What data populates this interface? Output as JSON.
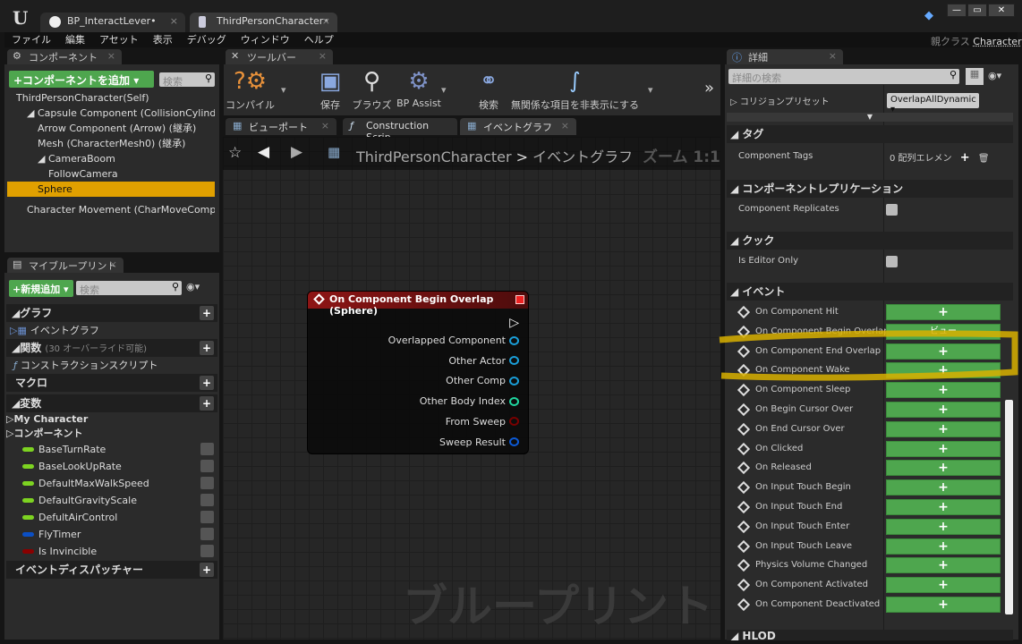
{
  "window": {
    "tabs": [
      {
        "label": "BP_InteractLever•"
      },
      {
        "label": "ThirdPersonCharacter•"
      }
    ],
    "parent_class_label": "親クラス",
    "parent_class": "Character",
    "controls": [
      "—",
      "▭",
      "✕"
    ]
  },
  "menu": [
    "ファイル",
    "編集",
    "アセット",
    "表示",
    "デバッグ",
    "ウィンドウ",
    "ヘルプ"
  ],
  "components": {
    "tab": "コンポーネント",
    "add_button": "+コンポーネントを追加",
    "search_placeholder": "検索",
    "tree": [
      {
        "label": "ThirdPersonCharacter(Self)",
        "indent": 0
      },
      {
        "label": "◢ Capsule Component (CollisionCylinder) (継承)",
        "indent": 1
      },
      {
        "label": "Arrow Component (Arrow) (継承)",
        "indent": 2
      },
      {
        "label": "Mesh (CharacterMesh0) (継承)",
        "indent": 2
      },
      {
        "label": "◢ CameraBoom",
        "indent": 2
      },
      {
        "label": "FollowCamera",
        "indent": 3
      },
      {
        "label": "Sphere",
        "indent": 2,
        "selected": true
      },
      {
        "label": "Character Movement (CharMoveComp) (継承)",
        "indent": 1
      }
    ]
  },
  "my_blueprint": {
    "tab": "マイブループリント",
    "add_button": "+新規追加",
    "search_placeholder": "検索",
    "graph_section": "◢グラフ",
    "event_graph": "イベントグラフ",
    "functions_section": "◢関数",
    "functions_note": "(30 オーバーライド可能)",
    "construction_script": "コンストラクションスクリプト",
    "macros_section": "マクロ",
    "variables_section": "◢変数",
    "my_character": "My Character",
    "components_cat": "コンポーネント",
    "variables": [
      {
        "name": "BaseTurnRate",
        "color": "#7dd321"
      },
      {
        "name": "BaseLookUpRate",
        "color": "#7dd321"
      },
      {
        "name": "DefaultMaxWalkSpeed",
        "color": "#7dd321"
      },
      {
        "name": "DefaultGravityScale",
        "color": "#7dd321"
      },
      {
        "name": "DefultAirControl",
        "color": "#7dd321"
      },
      {
        "name": "FlyTimer",
        "color": "#0b4fc4"
      },
      {
        "name": "Is Invincible",
        "color": "#8a0000"
      }
    ],
    "dispatchers_section": "イベントディスパッチャー"
  },
  "toolbar": {
    "tab": "ツールバー",
    "buttons": [
      "コンパイル",
      "保存",
      "ブラウズ",
      "BP Assist",
      "検索",
      "無関係な項目を非表示にする"
    ]
  },
  "graph_tabs": [
    {
      "label": "ビューポート"
    },
    {
      "label": "Construction Scrip"
    },
    {
      "label": "イベントグラフ"
    }
  ],
  "graph": {
    "breadcrumb_root": "ThirdPersonCharacter",
    "breadcrumb_sep": ">",
    "breadcrumb_current": "イベントグラフ",
    "zoom": "ズーム 1:1",
    "watermark": "ブループリント",
    "node": {
      "title": "On Component Begin Overlap (Sphere)",
      "pins": [
        {
          "label": "Overlapped Component",
          "color": "#1a9ed8"
        },
        {
          "label": "Other Actor",
          "color": "#1a9ed8"
        },
        {
          "label": "Other Comp",
          "color": "#1a9ed8"
        },
        {
          "label": "Other Body Index",
          "color": "#1fd6a0"
        },
        {
          "label": "From Sweep",
          "color": "#7a0000"
        },
        {
          "label": "Sweep Result",
          "color": "#0c5ad6"
        }
      ]
    }
  },
  "details": {
    "tab": "詳細",
    "search_placeholder": "詳細の検索",
    "collision_preset_label": "▷ コリジョンプリセット",
    "collision_preset_value": "OverlapAllDynamic ▾",
    "tags_section": "◢ タグ",
    "component_tags": "Component Tags",
    "tags_value": "0 配列エレメン",
    "replication_section": "◢ コンポーネントレプリケーション",
    "component_replicates": "Component Replicates",
    "cook_section": "◢ クック",
    "is_editor_only": "Is Editor Only",
    "events_section": "◢ イベント",
    "events": [
      {
        "label": "On Component Hit",
        "button": "+"
      },
      {
        "label": "On Component Begin Overlap",
        "button": "ビュー"
      },
      {
        "label": "On Component End Overlap",
        "button": "+"
      },
      {
        "label": "On Component Wake",
        "button": "+"
      },
      {
        "label": "On Component Sleep",
        "button": "+"
      },
      {
        "label": "On Begin Cursor Over",
        "button": "+"
      },
      {
        "label": "On End Cursor Over",
        "button": "+"
      },
      {
        "label": "On Clicked",
        "button": "+"
      },
      {
        "label": "On Released",
        "button": "+"
      },
      {
        "label": "On Input Touch Begin",
        "button": "+"
      },
      {
        "label": "On Input Touch End",
        "button": "+"
      },
      {
        "label": "On Input Touch Enter",
        "button": "+"
      },
      {
        "label": "On Input Touch Leave",
        "button": "+"
      },
      {
        "label": "Physics Volume Changed",
        "button": "+"
      },
      {
        "label": "On Component Activated",
        "button": "+"
      },
      {
        "label": "On Component Deactivated",
        "button": "+"
      }
    ],
    "hlod_section": "◢ HLOD"
  },
  "colors": {
    "accent_selected": "#e0a000",
    "green_button": "#4ea64e",
    "highlight_annotation": "#d8b000"
  }
}
